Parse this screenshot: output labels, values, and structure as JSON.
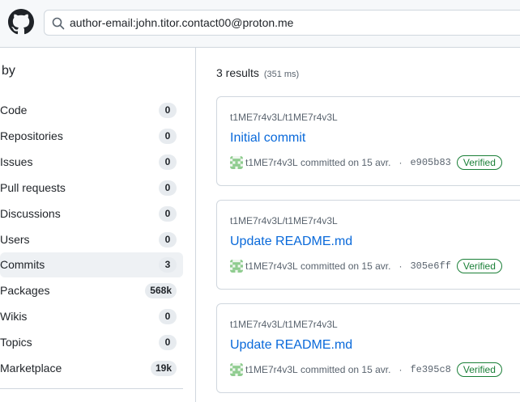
{
  "header": {
    "logo": "github-mark-icon",
    "search": {
      "value": "author-email:john.titor.contact00@proton.me",
      "icon": "search-icon"
    }
  },
  "sidebar": {
    "title": "by",
    "items": [
      {
        "label": "Code",
        "count": "0",
        "active": false
      },
      {
        "label": "Repositories",
        "count": "0",
        "active": false
      },
      {
        "label": "Issues",
        "count": "0",
        "active": false
      },
      {
        "label": "Pull requests",
        "count": "0",
        "active": false
      },
      {
        "label": "Discussions",
        "count": "0",
        "active": false
      },
      {
        "label": "Users",
        "count": "0",
        "active": false
      },
      {
        "label": "Commits",
        "count": "3",
        "active": true
      },
      {
        "label": "Packages",
        "count": "568k",
        "active": false
      },
      {
        "label": "Wikis",
        "count": "0",
        "active": false
      },
      {
        "label": "Topics",
        "count": "0",
        "active": false
      },
      {
        "label": "Marketplace",
        "count": "19k",
        "active": false
      }
    ]
  },
  "main": {
    "results_count": "3 results",
    "results_time": "(351 ms)",
    "results": [
      {
        "repo": "t1ME7r4v3L/t1ME7r4v3L",
        "title": "Initial commit",
        "author": "t1ME7r4v3L",
        "action": "committed on 15 avr.",
        "sha": "e905b83",
        "badge": "Verified"
      },
      {
        "repo": "t1ME7r4v3L/t1ME7r4v3L",
        "title": "Update README.md",
        "author": "t1ME7r4v3L",
        "action": "committed on 15 avr.",
        "sha": "305e6ff",
        "badge": "Verified"
      },
      {
        "repo": "t1ME7r4v3L/t1ME7r4v3L",
        "title": "Update README.md",
        "author": "t1ME7r4v3L",
        "action": "committed on 15 avr.",
        "sha": "fe395c8",
        "badge": "Verified"
      }
    ]
  },
  "colors": {
    "link": "#0969da",
    "verified": "#1a7f37",
    "avatar": "#8fcc8f"
  }
}
